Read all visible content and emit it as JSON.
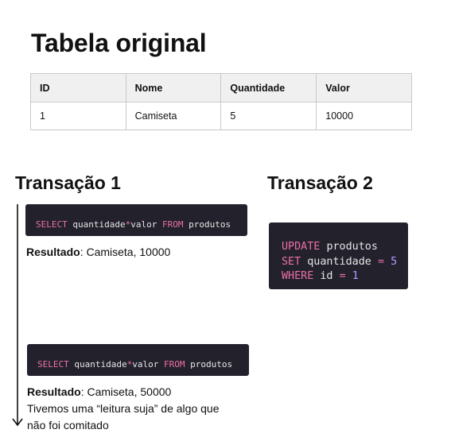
{
  "title": "Tabela original",
  "table": {
    "headers": [
      "ID",
      "Nome",
      "Quantidade",
      "Valor"
    ],
    "rows": [
      [
        "1",
        "Camiseta",
        "5",
        "10000"
      ]
    ]
  },
  "transaction1": {
    "title": "Transação 1",
    "query1": {
      "select_kw": "SELECT",
      "col1": "quantidade",
      "op": "*",
      "col2": "valor",
      "from_kw": "FROM",
      "table": "produtos"
    },
    "result1": {
      "label": "Resultado",
      "text": ": Camiseta, 10000"
    },
    "query2": {
      "select_kw": "SELECT",
      "col1": "quantidade",
      "op": "*",
      "col2": "valor",
      "from_kw": "FROM",
      "table": "produtos"
    },
    "result2": {
      "label": "Resultado",
      "text": ": Camiseta, 50000",
      "note_line1": "Tivemos uma “leitura suja” de algo que",
      "note_line2": "não foi comitado"
    }
  },
  "transaction2": {
    "title": "Transação 2",
    "query": {
      "update_kw": "UPDATE",
      "table": "produtos",
      "set_kw": "SET",
      "col": "quantidade",
      "eq1": "=",
      "val1": "5",
      "where_kw": "WHERE",
      "id_col": "id",
      "eq2": "=",
      "val2": "1"
    }
  },
  "colors": {
    "keyword": "#ee6fa6",
    "number": "#b499ff",
    "code_bg": "#22212c",
    "code_text": "#e6e6e6"
  }
}
